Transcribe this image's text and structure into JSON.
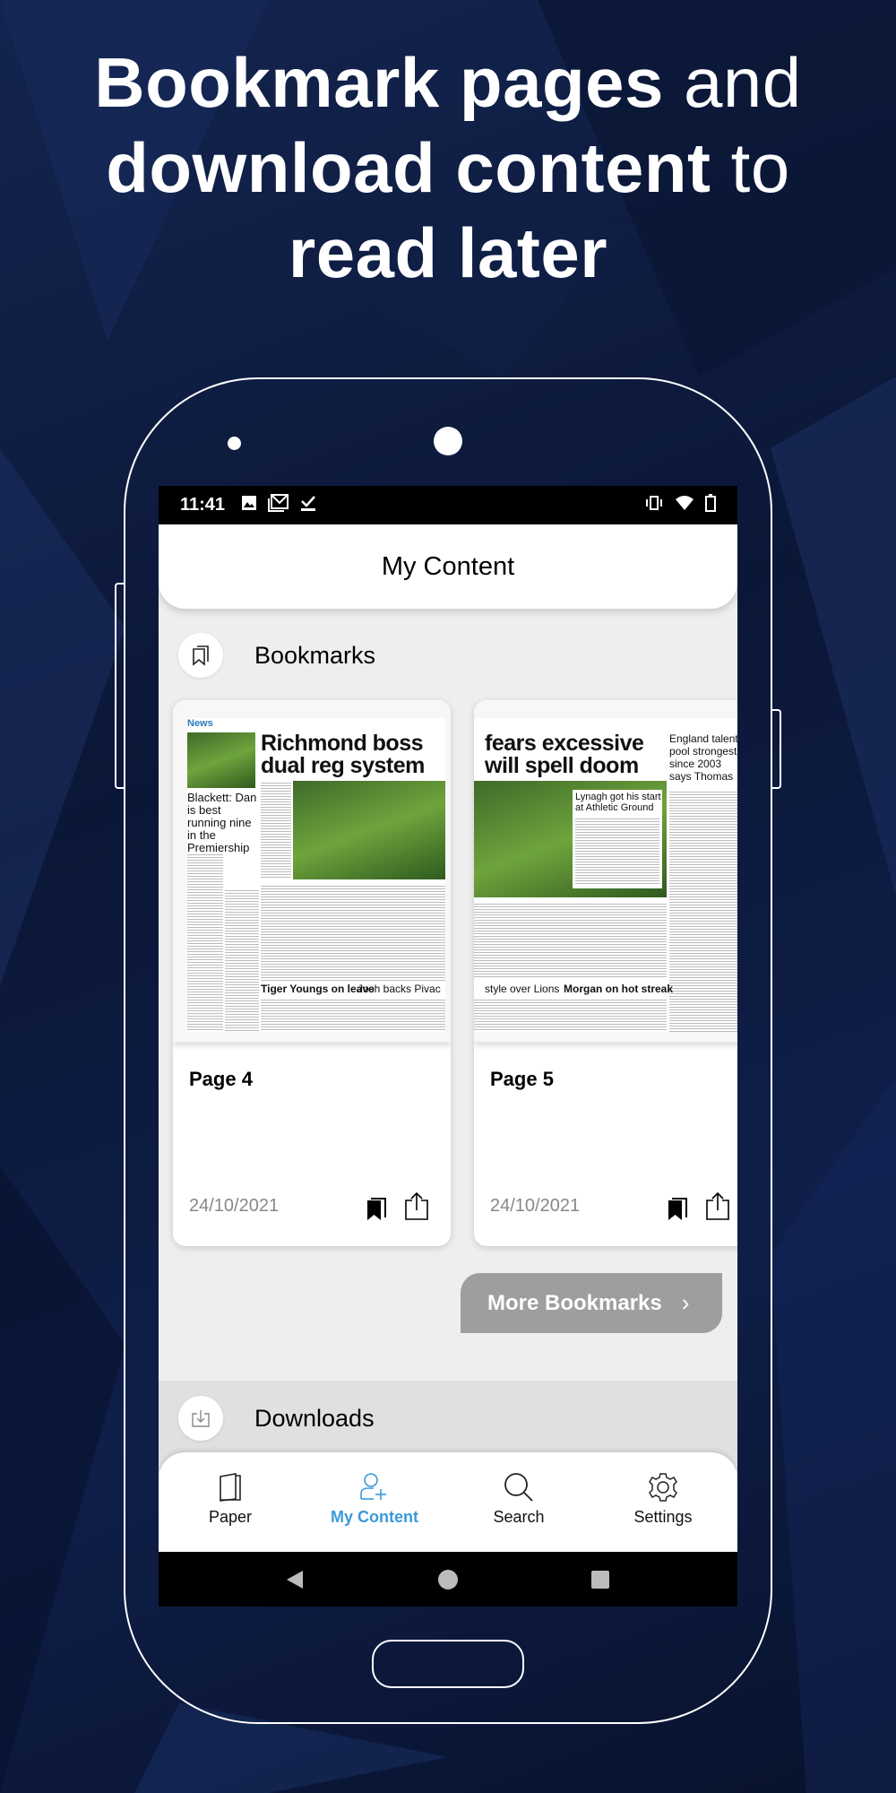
{
  "promo": {
    "line1_bold": "Bookmark pages",
    "line1_rest": " and",
    "line2_bold": "download content",
    "line2_rest": " to",
    "line3_bold": "read later"
  },
  "status_bar": {
    "time": "11:41",
    "left_icons": [
      "image-icon",
      "gmail-icon",
      "checkmark-icon"
    ],
    "right_icons": [
      "vibrate-icon",
      "wifi-icon",
      "battery-icon"
    ]
  },
  "header": {
    "title": "My Content"
  },
  "bookmarks": {
    "label": "Bookmarks",
    "items": [
      {
        "page": "Page 4",
        "date": "24/10/2021",
        "thumb": {
          "section": "News",
          "headline1": "Richmond boss",
          "headline2": "dual reg system",
          "side": "Blackett: Dan is best running nine in the Premiership",
          "sub1": "Tiger Youngs on leave",
          "sub2": "Josh backs Pivac"
        }
      },
      {
        "page": "Page 5",
        "date": "24/10/2021",
        "thumb": {
          "headline1": "fears excessive",
          "headline2": "will spell doom",
          "side": "England talent pool strongest since 2003 says Thomas",
          "caption": "Lynagh got his start at Athletic Ground",
          "sub1": "style over Lions",
          "sub2": "Morgan on hot streak"
        }
      }
    ],
    "more_label": "More Bookmarks"
  },
  "downloads": {
    "label": "Downloads"
  },
  "bottom_nav": {
    "items": [
      {
        "label": "Paper",
        "icon": "paper-icon"
      },
      {
        "label": "My Content",
        "icon": "user-add-icon",
        "active": true
      },
      {
        "label": "Search",
        "icon": "search-icon"
      },
      {
        "label": "Settings",
        "icon": "gear-icon"
      }
    ]
  },
  "colors": {
    "accent": "#3a9ad9",
    "more_button": "#9e9e9e",
    "background": "#0d1a3f"
  }
}
